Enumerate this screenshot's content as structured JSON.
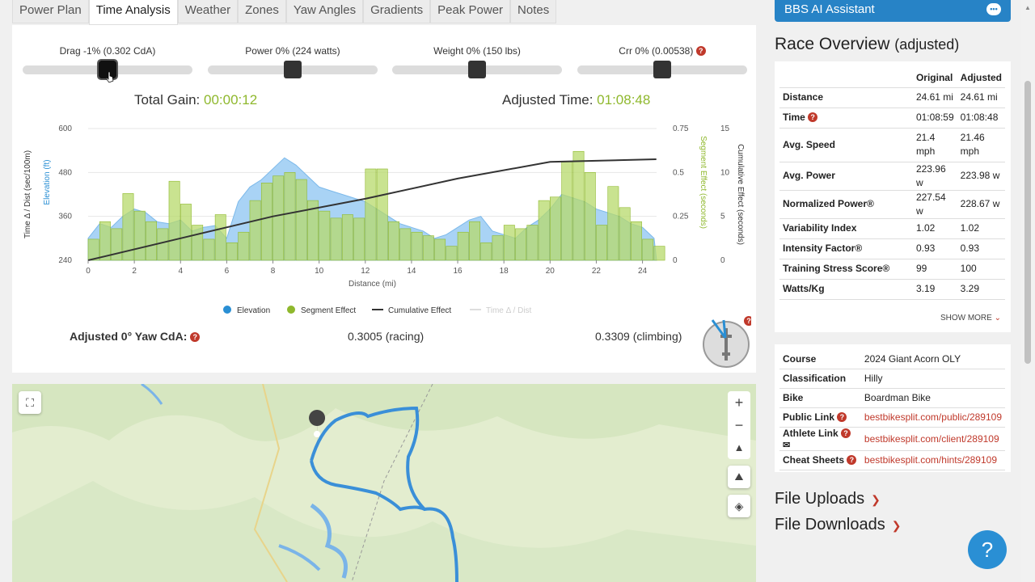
{
  "tabs": [
    {
      "label": "Power Plan"
    },
    {
      "label": "Time Analysis",
      "active": true
    },
    {
      "label": "Weather"
    },
    {
      "label": "Zones"
    },
    {
      "label": "Yaw Angles"
    },
    {
      "label": "Gradients"
    },
    {
      "label": "Peak Power"
    },
    {
      "label": "Notes"
    }
  ],
  "sliders": [
    {
      "label": "Drag -1% (0.302 CdA)",
      "value_fraction": 0.5
    },
    {
      "label": "Power 0% (224 watts)",
      "value_fraction": 0.5
    },
    {
      "label": "Weight 0% (150 lbs)",
      "value_fraction": 0.5
    },
    {
      "label": "Crr 0% (0.00538)",
      "value_fraction": 0.5
    }
  ],
  "gain": {
    "label": "Total Gain: ",
    "value": "00:00:12"
  },
  "adjusted": {
    "label": "Adjusted Time: ",
    "value": "01:08:48"
  },
  "chart_data": {
    "type": "area",
    "xlabel": "Distance (mi)",
    "x_ticks": [
      "0",
      "2",
      "4",
      "6",
      "8",
      "10",
      "12",
      "14",
      "16",
      "18",
      "20",
      "22",
      "24"
    ],
    "xlim": [
      0,
      24.61
    ],
    "y_left_outer_label": "Time Δ / Dist (sec/100m)",
    "y_left_outer_ticks": [
      "240",
      "360",
      "480",
      "600"
    ],
    "y_left_inner_label": "Elevation (ft)",
    "y_right_inner_label": "Segment Effect (seconds)",
    "y_right_inner_ticks": [
      "0",
      "0.25",
      "0.5",
      "0.75"
    ],
    "y_right_outer_label": "Cumulative Effect (seconds)",
    "y_right_outer_ticks": [
      "0",
      "5",
      "10",
      "15"
    ],
    "legend": [
      "Elevation",
      "Segment Effect",
      "Cumulative Effect",
      "Time Δ / Dist"
    ],
    "elevation": {
      "x": [
        0,
        0.5,
        1,
        1.5,
        2,
        2.5,
        3,
        3.5,
        4,
        4.5,
        5,
        5.5,
        6,
        6.5,
        7,
        7.5,
        8,
        8.5,
        9,
        9.5,
        10,
        10.5,
        11,
        11.5,
        12,
        12.5,
        13,
        13.5,
        14,
        14.5,
        15,
        15.5,
        16,
        16.5,
        17,
        17.5,
        18,
        18.5,
        19,
        19.5,
        20,
        20.5,
        21,
        21.5,
        22,
        22.5,
        23,
        23.5,
        24,
        24.5
      ],
      "y": [
        300,
        340,
        330,
        360,
        380,
        370,
        345,
        340,
        350,
        320,
        330,
        335,
        300,
        400,
        440,
        460,
        490,
        520,
        500,
        470,
        440,
        430,
        420,
        410,
        400,
        380,
        360,
        340,
        330,
        320,
        300,
        310,
        330,
        350,
        360,
        320,
        310,
        300,
        330,
        350,
        380,
        420,
        410,
        400,
        380,
        370,
        360,
        340,
        330,
        300
      ]
    },
    "segment_effect": {
      "x": [
        0,
        0.5,
        1,
        1.5,
        2,
        2.5,
        3,
        3.5,
        4,
        4.5,
        5,
        5.5,
        6,
        6.5,
        7,
        7.5,
        8,
        8.5,
        9,
        9.5,
        10,
        10.5,
        11,
        11.5,
        12,
        12.5,
        13,
        13.5,
        14,
        14.5,
        15,
        15.5,
        16,
        16.5,
        17,
        17.5,
        18,
        18.5,
        19,
        19.5,
        20,
        20.5,
        21,
        21.5,
        22,
        22.5,
        23,
        23.5,
        24,
        24.5
      ],
      "y": [
        0.12,
        0.22,
        0.18,
        0.38,
        0.28,
        0.22,
        0.18,
        0.45,
        0.32,
        0.2,
        0.12,
        0.26,
        0.1,
        0.16,
        0.34,
        0.44,
        0.48,
        0.5,
        0.46,
        0.34,
        0.28,
        0.24,
        0.26,
        0.24,
        0.52,
        0.52,
        0.22,
        0.18,
        0.16,
        0.14,
        0.12,
        0.08,
        0.16,
        0.22,
        0.1,
        0.14,
        0.2,
        0.18,
        0.2,
        0.34,
        0.36,
        0.56,
        0.62,
        0.5,
        0.2,
        0.42,
        0.3,
        0.22,
        0.12,
        0.08
      ]
    },
    "cumulative_effect": {
      "x": [
        0,
        4,
        8,
        12,
        16,
        20,
        24.6
      ],
      "y": [
        0,
        2.5,
        5,
        7,
        9.3,
        11.2,
        11.5
      ]
    }
  },
  "yaw": {
    "label": "Adjusted 0° Yaw CdA:",
    "racing": "0.3005 (racing)",
    "climbing": "0.3309 (climbing)"
  },
  "map": {
    "zoom_in": "+",
    "zoom_out": "−"
  },
  "ai_label": "BBS AI Assistant",
  "race_overview": {
    "title": "Race Overview",
    "subtitle": "(adjusted)",
    "col_original": "Original",
    "col_adjusted": "Adjusted",
    "rows": [
      {
        "k": "Distance",
        "o": "24.61 mi",
        "a": "24.61 mi"
      },
      {
        "k": "Time",
        "o": "01:08:59",
        "a": "01:08:48",
        "q": true
      },
      {
        "k": "Avg. Speed",
        "o": "21.4 mph",
        "a": "21.46 mph"
      },
      {
        "k": "Avg. Power",
        "o": "223.96 w",
        "a": "223.98 w"
      },
      {
        "k": "Normalized Power®",
        "o": "227.54 w",
        "a": "228.67 w"
      },
      {
        "k": "Variability Index",
        "o": "1.02",
        "a": "1.02"
      },
      {
        "k": "Intensity Factor®",
        "o": "0.93",
        "a": "0.93"
      },
      {
        "k": "Training Stress Score®",
        "o": "99",
        "a": "100"
      },
      {
        "k": "Watts/Kg",
        "o": "3.19",
        "a": "3.29"
      }
    ],
    "show_more": "SHOW MORE"
  },
  "course": [
    {
      "k": "Course",
      "v": "2024 Giant Acorn OLY"
    },
    {
      "k": "Classification",
      "v": "Hilly"
    },
    {
      "k": "Bike",
      "v": "Boardman Bike"
    },
    {
      "k": "Public Link",
      "v": "bestbikesplit.com/public/289109",
      "link": true,
      "q": true
    },
    {
      "k": "Athlete Link",
      "v": "bestbikesplit.com/client/289109",
      "link": true,
      "q": true,
      "mail": true
    },
    {
      "k": "Cheat Sheets",
      "v": "bestbikesplit.com/hints/289109",
      "link": true,
      "q": true
    }
  ],
  "file_uploads": "File Uploads",
  "file_downloads": "File Downloads",
  "help": "?",
  "colors": {
    "accent": "#2783c6",
    "green": "#8fb82d",
    "seg": "#b7d96b",
    "elev": "#a9d3f5",
    "link": "#c0392b"
  }
}
